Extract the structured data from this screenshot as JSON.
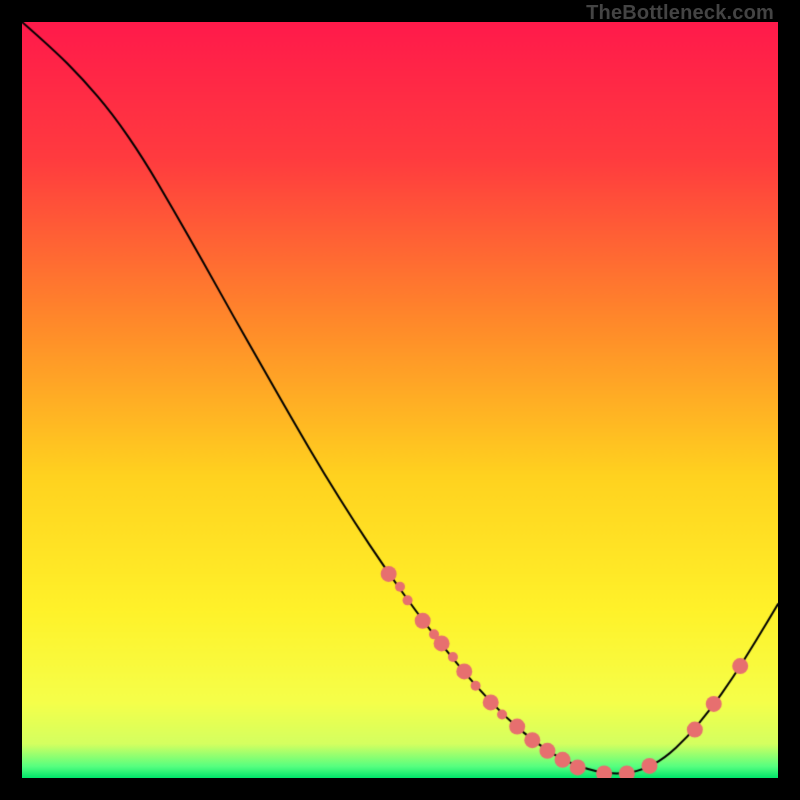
{
  "watermark": "TheBottleneck.com",
  "chart_data": {
    "type": "line",
    "title": "",
    "xlabel": "",
    "ylabel": "",
    "xlim": [
      0,
      100
    ],
    "ylim": [
      0,
      100
    ],
    "background_gradient": {
      "stops": [
        {
          "pos": 0.0,
          "color": "#ff1a4b"
        },
        {
          "pos": 0.18,
          "color": "#ff3b3f"
        },
        {
          "pos": 0.4,
          "color": "#ff8a2a"
        },
        {
          "pos": 0.6,
          "color": "#ffd21f"
        },
        {
          "pos": 0.78,
          "color": "#fff22a"
        },
        {
          "pos": 0.9,
          "color": "#f5ff4a"
        },
        {
          "pos": 0.955,
          "color": "#d4ff60"
        },
        {
          "pos": 0.985,
          "color": "#55ff80"
        },
        {
          "pos": 1.0,
          "color": "#00e56a"
        }
      ]
    },
    "curve": {
      "name": "bottleneck-curve",
      "color": "#000000",
      "width": 2,
      "points": [
        {
          "x": 0,
          "y": 100
        },
        {
          "x": 4,
          "y": 96.5
        },
        {
          "x": 8,
          "y": 92.5
        },
        {
          "x": 12,
          "y": 87.8
        },
        {
          "x": 16,
          "y": 82.0
        },
        {
          "x": 20,
          "y": 75.2
        },
        {
          "x": 24,
          "y": 68.2
        },
        {
          "x": 28,
          "y": 61.0
        },
        {
          "x": 32,
          "y": 54.0
        },
        {
          "x": 36,
          "y": 47.0
        },
        {
          "x": 40,
          "y": 40.2
        },
        {
          "x": 44,
          "y": 33.8
        },
        {
          "x": 48,
          "y": 27.8
        },
        {
          "x": 52,
          "y": 22.2
        },
        {
          "x": 56,
          "y": 17.0
        },
        {
          "x": 60,
          "y": 12.2
        },
        {
          "x": 64,
          "y": 8.0
        },
        {
          "x": 68,
          "y": 4.6
        },
        {
          "x": 72,
          "y": 2.1
        },
        {
          "x": 76,
          "y": 0.8
        },
        {
          "x": 79,
          "y": 0.5
        },
        {
          "x": 82,
          "y": 1.0
        },
        {
          "x": 85,
          "y": 2.6
        },
        {
          "x": 88,
          "y": 5.4
        },
        {
          "x": 91,
          "y": 9.0
        },
        {
          "x": 94,
          "y": 13.2
        },
        {
          "x": 97,
          "y": 18.0
        },
        {
          "x": 100,
          "y": 23.0
        }
      ]
    },
    "markers": {
      "name": "curve-dots",
      "color": "#e76f6f",
      "radius_small": 5,
      "radius_large": 8,
      "points": [
        {
          "x": 48.5,
          "y": 27.0,
          "r": "large"
        },
        {
          "x": 50.0,
          "y": 25.3,
          "r": "small"
        },
        {
          "x": 51.0,
          "y": 23.5,
          "r": "small"
        },
        {
          "x": 53.0,
          "y": 20.8,
          "r": "large"
        },
        {
          "x": 54.5,
          "y": 19.0,
          "r": "small"
        },
        {
          "x": 55.5,
          "y": 17.8,
          "r": "large"
        },
        {
          "x": 57.0,
          "y": 16.0,
          "r": "small"
        },
        {
          "x": 58.5,
          "y": 14.1,
          "r": "large"
        },
        {
          "x": 60.0,
          "y": 12.2,
          "r": "small"
        },
        {
          "x": 62.0,
          "y": 10.0,
          "r": "large"
        },
        {
          "x": 63.5,
          "y": 8.4,
          "r": "small"
        },
        {
          "x": 65.5,
          "y": 6.8,
          "r": "large"
        },
        {
          "x": 67.5,
          "y": 5.0,
          "r": "large"
        },
        {
          "x": 69.5,
          "y": 3.6,
          "r": "large"
        },
        {
          "x": 71.5,
          "y": 2.4,
          "r": "large"
        },
        {
          "x": 73.5,
          "y": 1.4,
          "r": "large"
        },
        {
          "x": 77.0,
          "y": 0.6,
          "r": "large"
        },
        {
          "x": 80.0,
          "y": 0.6,
          "r": "large"
        },
        {
          "x": 83.0,
          "y": 1.6,
          "r": "large"
        },
        {
          "x": 89.0,
          "y": 6.4,
          "r": "large"
        },
        {
          "x": 91.5,
          "y": 9.8,
          "r": "large"
        },
        {
          "x": 95.0,
          "y": 14.8,
          "r": "large"
        }
      ]
    }
  }
}
